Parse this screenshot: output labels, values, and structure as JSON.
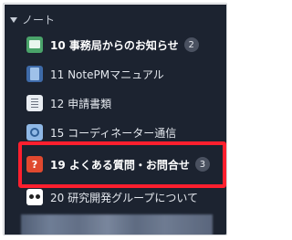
{
  "section": {
    "title": "ノート",
    "caret_icon": "caret-down-icon"
  },
  "items": [
    {
      "label": "10 事務局からのお知らせ",
      "badge": "2",
      "icon": "notice-board-icon",
      "bold": true
    },
    {
      "label": "11 NotePMマニュアル",
      "badge": "",
      "icon": "manual-book-icon",
      "bold": false
    },
    {
      "label": "12 申請書類",
      "badge": "",
      "icon": "document-icon",
      "bold": false
    },
    {
      "label": "15 コーディネーター通信",
      "badge": "",
      "icon": "link-icon",
      "bold": false
    },
    {
      "label": "19 よくある質問・お問合せ",
      "badge": "3",
      "icon": "question-icon",
      "icon_text": "?",
      "bold": true
    },
    {
      "label": "20 研究開発グループについて",
      "badge": "",
      "icon": "group-icon",
      "bold": false
    }
  ],
  "colors": {
    "sidebar_bg": "#1c2330",
    "highlight": "#ff1f2e",
    "badge_bg": "#4a5160"
  }
}
